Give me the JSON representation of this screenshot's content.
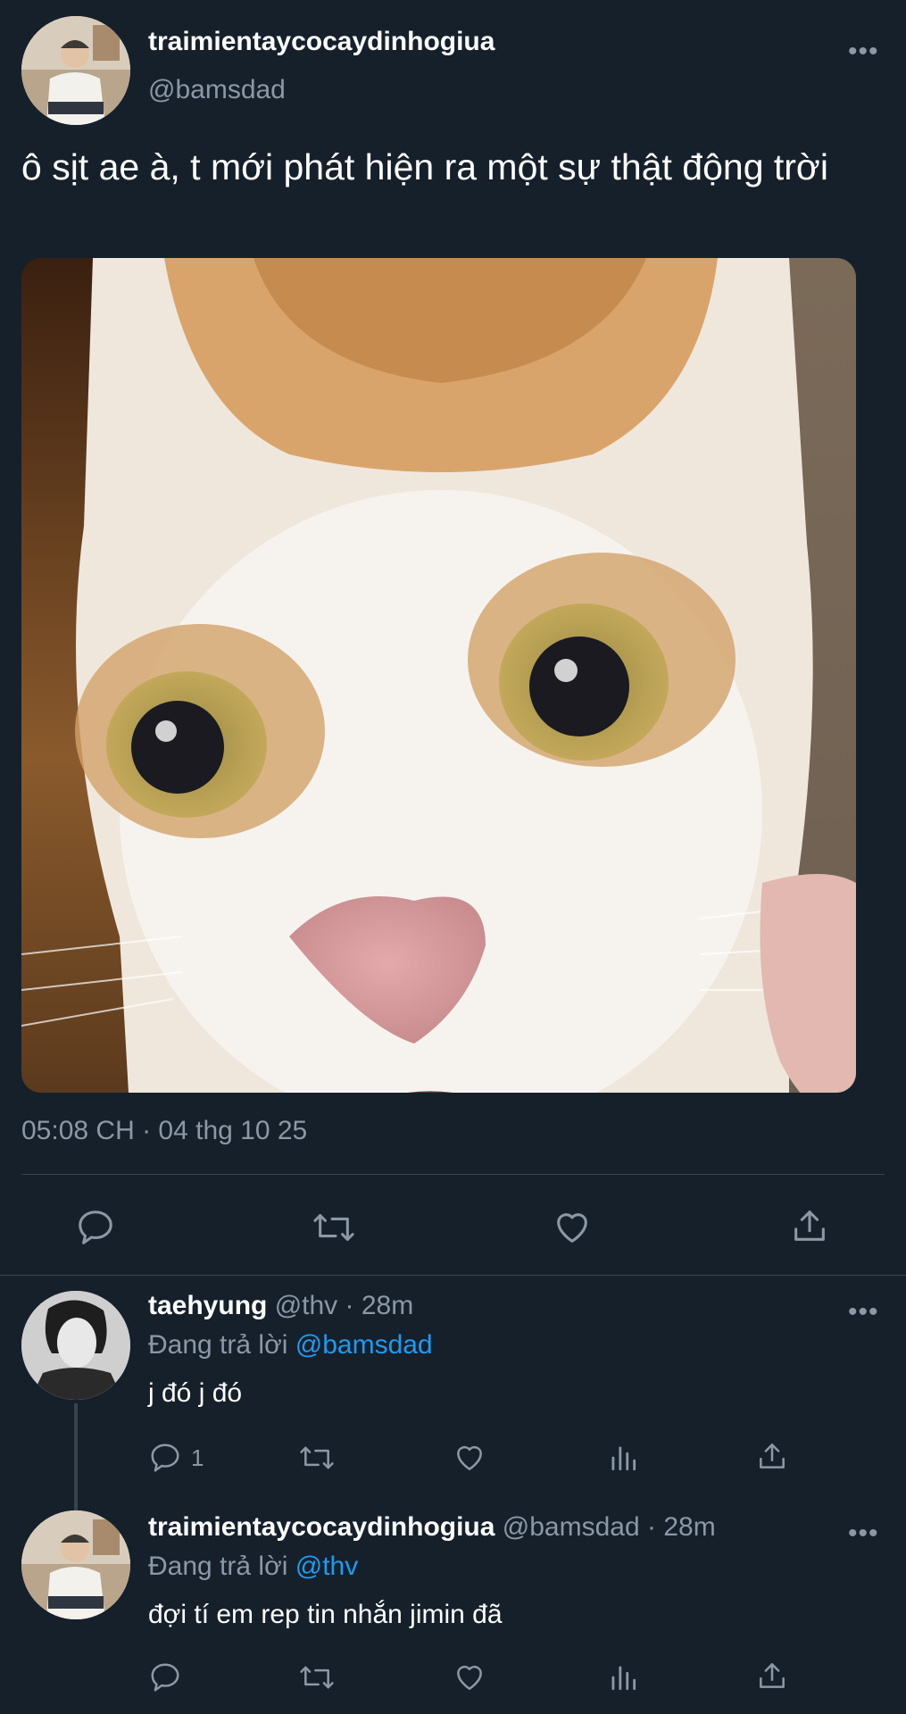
{
  "main_tweet": {
    "display_name": "traimientaycocaydinhogiua",
    "handle": "@bamsdad",
    "text": "ô sịt ae à, t mới phát hiện ra một sự thật động trời",
    "timestamp": "05:08 CH · 04 thg 10 25",
    "more_label": "•••",
    "media_description": "Close-up photo of a surprised white and orange cat"
  },
  "replies": [
    {
      "display_name": "taehyung",
      "handle": "@thv",
      "time": "· 28m",
      "replying_prefix": "Đang trả lời",
      "replying_to": "@bamsdad",
      "text": "j đó j đó",
      "reply_count": "1",
      "more_label": "•••"
    },
    {
      "display_name": "traimientaycocaydinhogiua",
      "handle": "@bamsdad",
      "time": "· 28m",
      "replying_prefix": "Đang trả lời",
      "replying_to": "@thv",
      "text": "đợi tí em rep tin nhắn jimin đã",
      "reply_count": "",
      "more_label": "•••"
    }
  ],
  "colors": {
    "background": "#15202b",
    "text": "#ffffff",
    "muted": "#8b98a5",
    "link": "#1d9bf0",
    "divider": "#38444d"
  }
}
